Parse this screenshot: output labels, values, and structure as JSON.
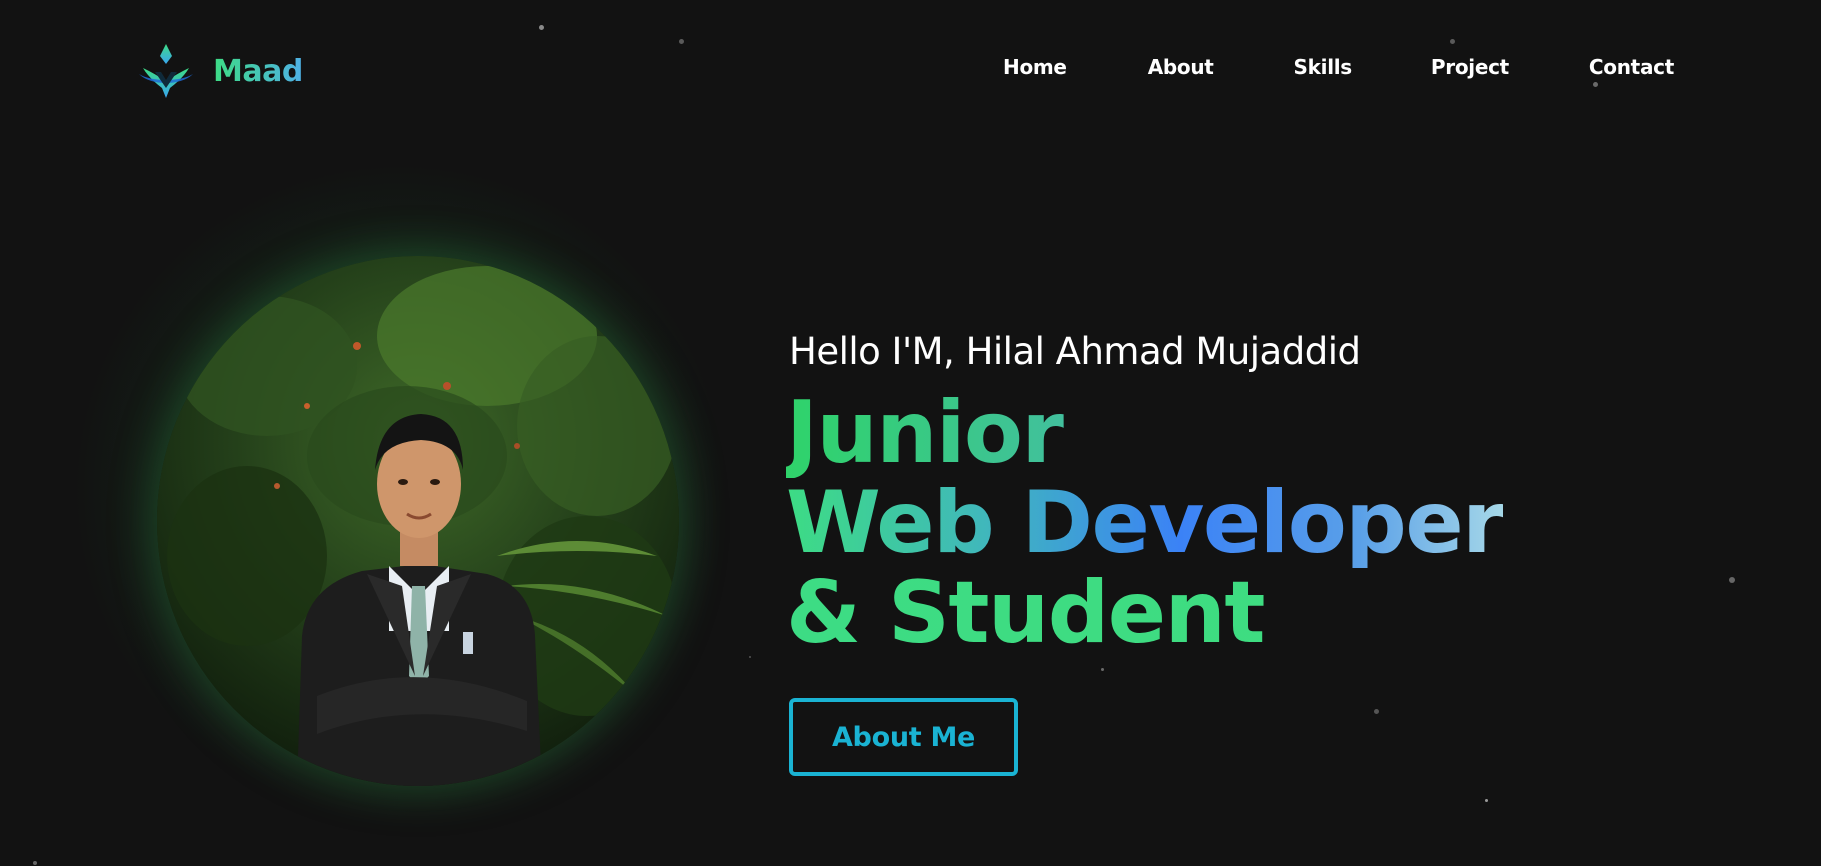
{
  "brand": {
    "name": "Maad",
    "logo_icon": "maad-logo-icon",
    "gradient_from": "#3ddc84",
    "gradient_to": "#4fb0e6"
  },
  "nav": {
    "items": [
      {
        "label": "Home"
      },
      {
        "label": "About"
      },
      {
        "label": "Skills"
      },
      {
        "label": "Project"
      },
      {
        "label": "Contact"
      }
    ]
  },
  "hero": {
    "greeting": "Hello I'M, Hilal Ahmad Mujaddid",
    "headline": [
      "Junior",
      "Web Developer",
      "& Student"
    ],
    "cta_label": "About Me",
    "portrait_icon": "profile-photo",
    "accent_green": "#3ddc84",
    "accent_blue": "#3b82f6",
    "accent_cyan": "#1ab3d3"
  },
  "theme": {
    "background": "#121212",
    "text": "#ffffff"
  }
}
